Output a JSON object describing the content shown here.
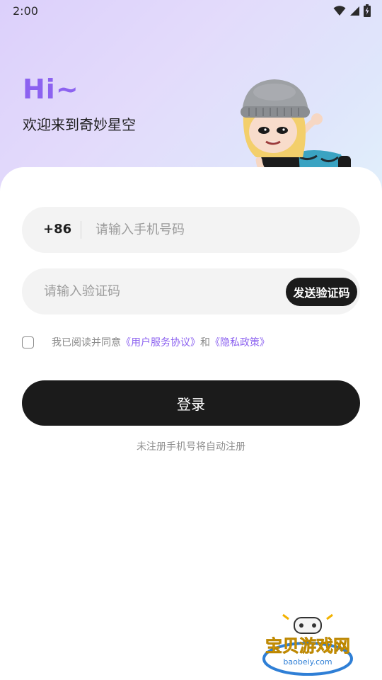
{
  "status_bar": {
    "time": "2:00",
    "icons": [
      "wifi-icon",
      "signal-icon",
      "battery-charging-icon"
    ]
  },
  "header": {
    "greeting": "Hi~",
    "welcome": "欢迎来到奇妙星空",
    "mascot": "mascot-girl-in-beanie-image"
  },
  "phone": {
    "country_code": "+86",
    "placeholder": "请输入手机号码",
    "value": ""
  },
  "verify": {
    "placeholder": "请输入验证码",
    "value": "",
    "send_label": "发送验证码"
  },
  "agreement": {
    "checked": false,
    "prefix": "我已阅读并同意",
    "terms_link": "《用户服务协议》",
    "conjunction": "和",
    "privacy_link": "《隐私政策》"
  },
  "login": {
    "label": "登录",
    "hint": "未注册手机号将自动注册"
  },
  "watermark": {
    "title": "宝贝游戏网",
    "url": "baobeiy.com"
  },
  "colors": {
    "accent": "#8c62f0",
    "button": "#1b1b1b",
    "field_bg": "#f3f3f3"
  }
}
